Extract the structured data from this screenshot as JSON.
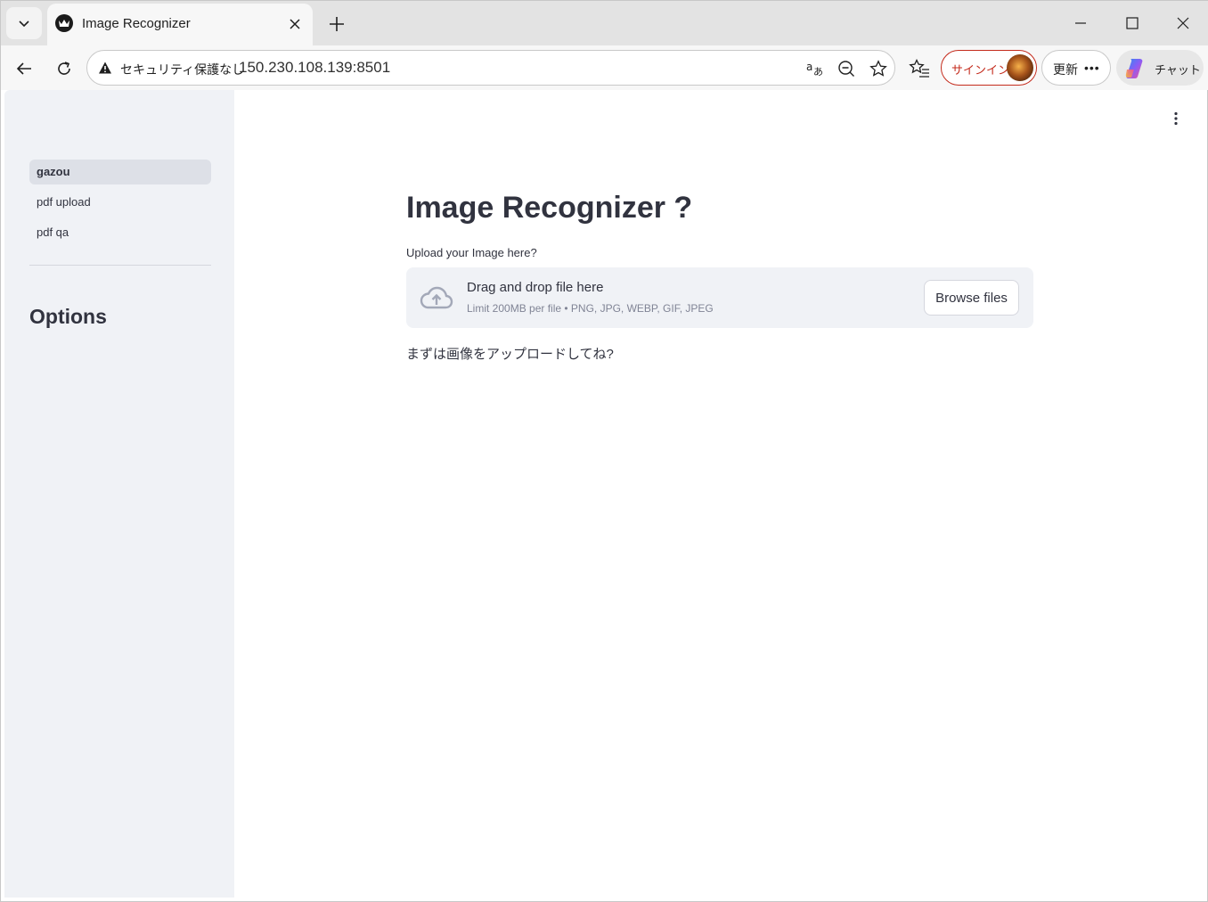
{
  "browser": {
    "tab_title": "Image Recognizer",
    "security_label": "セキュリティ保護なし",
    "url": "150.230.108.139:8501",
    "signin_label": "サインイン",
    "update_label": "更新",
    "update_more": "•••",
    "chat_label": "チャット"
  },
  "sidebar": {
    "nav_items": [
      {
        "label": "gazou",
        "active": true
      },
      {
        "label": "pdf upload",
        "active": false
      },
      {
        "label": "pdf qa",
        "active": false
      }
    ],
    "heading": "Options"
  },
  "main": {
    "title": "Image Recognizer ?",
    "uploader": {
      "label": "Upload your Image here?",
      "drop_title": "Drag and drop file here",
      "limit_text": "Limit 200MB per file • PNG, JPG, WEBP, GIF, JPEG",
      "browse_label": "Browse files"
    },
    "info_text": "まずは画像をアップロードしてね?"
  },
  "icons": [
    "chevron-down-icon",
    "favicon-icon",
    "close-icon",
    "plus-icon",
    "minimize-icon",
    "maximize-icon",
    "back-icon",
    "reload-icon",
    "warning-icon",
    "translate-icon",
    "zoom-out-icon",
    "star-icon",
    "favorites-icon",
    "copilot-icon",
    "kebab-menu-icon",
    "cloud-upload-icon"
  ]
}
